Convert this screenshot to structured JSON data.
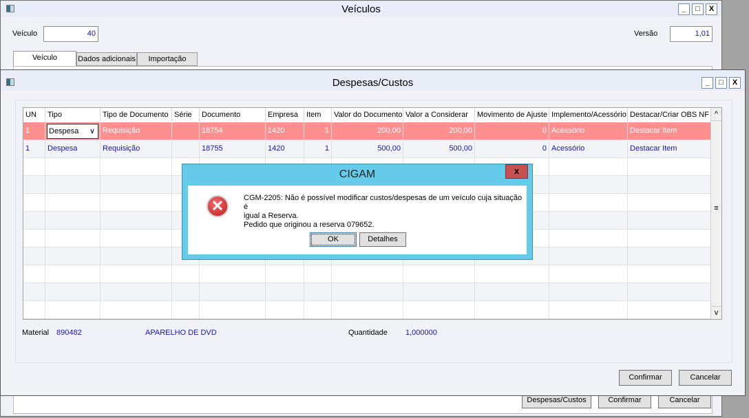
{
  "outer": {
    "title": "Veículos",
    "veiculo_label": "Veículo",
    "veiculo_value": "40",
    "versao_label": "Versão",
    "versao_value": "1,01",
    "tabs": [
      "Veículo",
      "Dados adicionais",
      "Importação"
    ],
    "buttons": {
      "despesas": "Despesas/Custos",
      "confirmar": "Confirmar",
      "cancelar": "Cancelar"
    }
  },
  "inner": {
    "title": "Despesas/Custos",
    "columns": [
      "UN",
      "Tipo",
      "Tipo de Documento",
      "Série",
      "Documento",
      "Empresa",
      "Item",
      "Valor do Documento",
      "Valor a Considerar",
      "Movimento de Ajuste",
      "Implemento/Acessório",
      "Destacar/Criar OBS NF"
    ],
    "rows": [
      [
        "1",
        "Despesa",
        "Requisição",
        "",
        "18754",
        "1420",
        "1",
        "200,00",
        "200,00",
        "0",
        "Acessório",
        "Destacar Item"
      ],
      [
        "1",
        "Despesa",
        "Requisição",
        "",
        "18755",
        "1420",
        "1",
        "500,00",
        "500,00",
        "0",
        "Acessório",
        "Destacar Item"
      ]
    ],
    "material_label": "Material",
    "material_code": "890482",
    "material_desc": "APARELHO DE DVD",
    "quantidade_label": "Quantidade",
    "quantidade_value": "1,000000",
    "buttons": {
      "confirmar": "Confirmar",
      "cancelar": "Cancelar"
    }
  },
  "dialog": {
    "title": "CIGAM",
    "message_line1": "CGM-2205: Não é possível modificar custos/despesas de um veículo cuja situação é",
    "message_line2": "igual a Reserva.",
    "message_line3": "Pedido que originou a reserva 079652.",
    "ok": "OK",
    "details": "Detalhes",
    "close": "x",
    "icon": "error-icon"
  },
  "colors": {
    "selected_row": "#fd8f8f",
    "dialog_title": "#66cbea",
    "value_text": "#1414b4"
  }
}
